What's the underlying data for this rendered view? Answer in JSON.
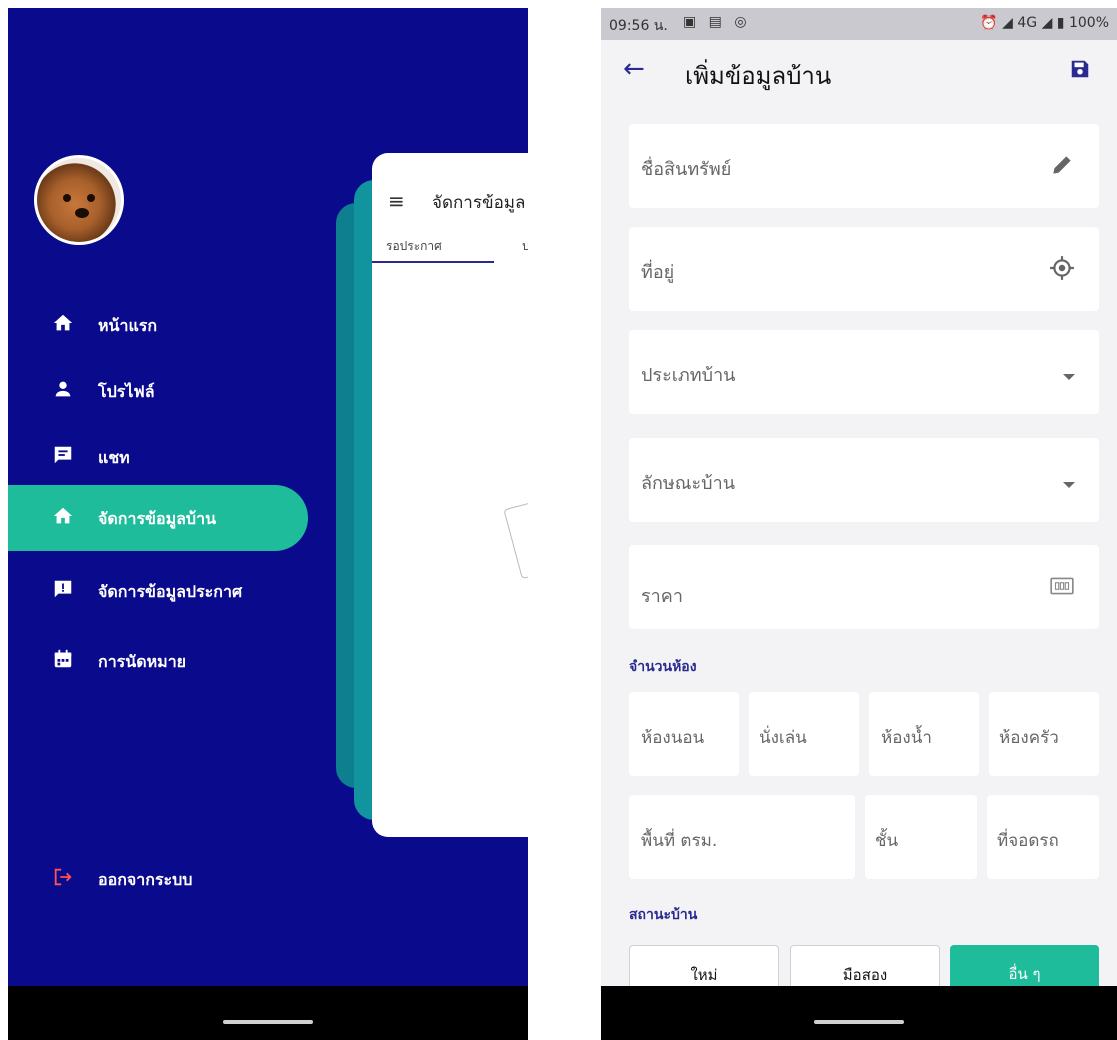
{
  "left": {
    "menu": [
      {
        "label": "หน้าแรก",
        "icon": "home-icon"
      },
      {
        "label": "โปรไฟล์",
        "icon": "person-icon"
      },
      {
        "label": "แชท",
        "icon": "chat-icon"
      },
      {
        "label": "จัดการข้อมูลบ้าน",
        "icon": "home-icon",
        "active": true
      },
      {
        "label": "จัดการข้อมูลประกาศ",
        "icon": "alert-icon"
      },
      {
        "label": "การนัดหมาย",
        "icon": "calendar-icon"
      }
    ],
    "logout_label": "ออกจากระบบ",
    "peek": {
      "title": "จัดการข้อมูล",
      "tab_active": "รอประกาศ",
      "tab_next": "ป"
    }
  },
  "right": {
    "status": {
      "time": "09:56 น.",
      "battery": "100%",
      "network": "4G"
    },
    "title": "เพิ่มข้อมูลบ้าน",
    "fields": {
      "asset_name": "ชื่อสินทรัพย์",
      "address": "ที่อยู่",
      "house_type": "ประเภทบ้าน",
      "house_style": "ลักษณะบ้าน",
      "price": "ราคา"
    },
    "rooms_section": "จำนวนห้อง",
    "rooms": {
      "bedroom": "ห้องนอน",
      "living": "นั่งเล่น",
      "bathroom": "ห้องน้ำ",
      "kitchen": "ห้องครัว",
      "area": "พื้นที่ ตรม.",
      "floors": "ชั้น",
      "parking": "ที่จอดรถ"
    },
    "status_section": "สถานะบ้าน",
    "status_options": {
      "new": "ใหม่",
      "used": "มือสอง",
      "other": "อื่น ๆ"
    }
  },
  "colors": {
    "drawer_bg": "#0a0a8c",
    "accent": "#1fbc9c",
    "primary": "#2a2a90"
  }
}
